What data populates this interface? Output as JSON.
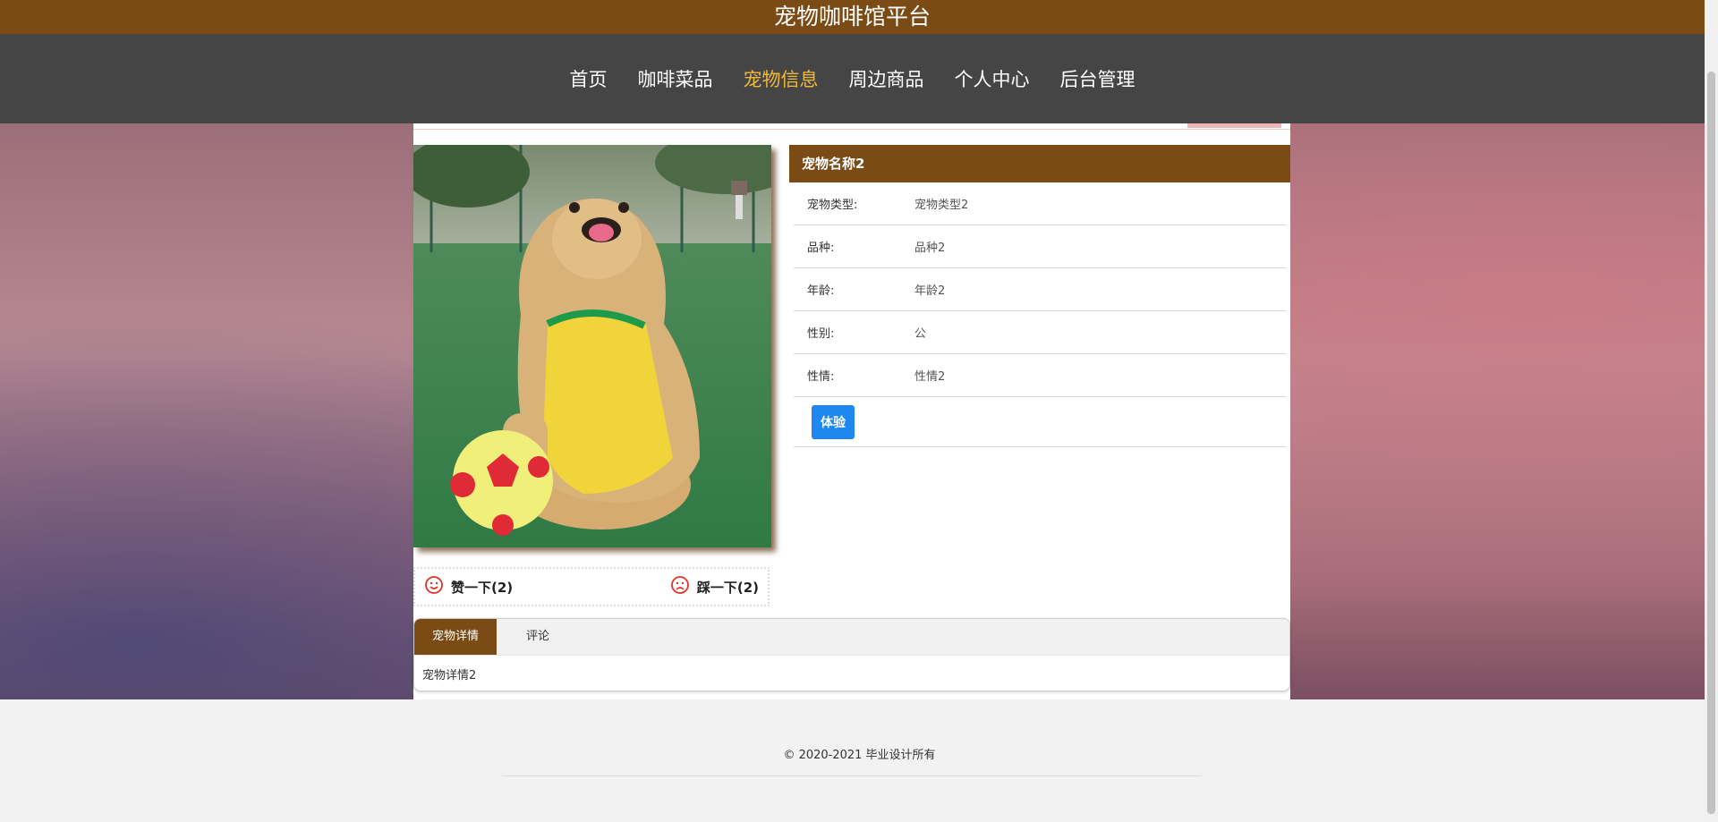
{
  "site": {
    "title": "宠物咖啡馆平台"
  },
  "nav": {
    "items": [
      "首页",
      "咖啡菜品",
      "宠物信息",
      "周边商品",
      "个人中心",
      "后台管理"
    ],
    "active": "宠物信息"
  },
  "pet": {
    "name": "宠物名称2",
    "fields": [
      {
        "label": "宠物类型:",
        "value": "宠物类型2"
      },
      {
        "label": "品种:",
        "value": "品种2"
      },
      {
        "label": "年龄:",
        "value": "年龄2"
      },
      {
        "label": "性别:",
        "value": "公"
      },
      {
        "label": "性情:",
        "value": "性情2"
      }
    ],
    "action_label": "体验",
    "like_label": "赞一下(2)",
    "dislike_label": "踩一下(2)"
  },
  "tabs": {
    "items": [
      "宠物详情",
      "评论"
    ],
    "active": "宠物详情",
    "content": "宠物详情2"
  },
  "footer": {
    "copyright": "© 2020-2021 毕业设计所有"
  },
  "colors": {
    "brand": "#7b4b16",
    "nav_bg": "#454545",
    "nav_active": "#f0b93e",
    "button": "#1e87f0",
    "vote_icon": "#e0322a"
  }
}
